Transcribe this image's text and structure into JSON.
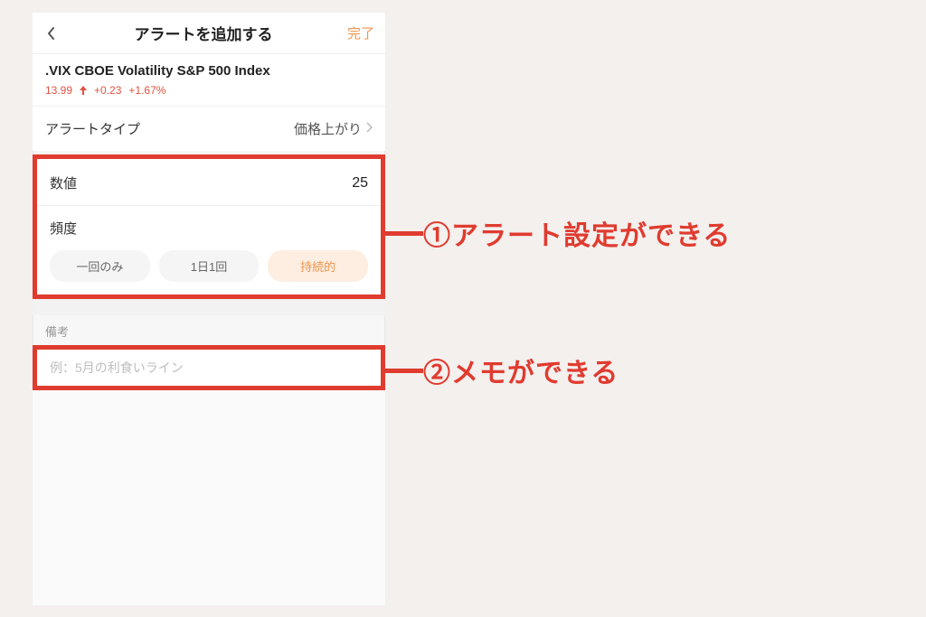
{
  "header": {
    "title": "アラートを追加する",
    "done_label": "完了"
  },
  "ticker": {
    "name": ".VIX  CBOE Volatility S&P 500 Index",
    "price": "13.99",
    "change": "+0.23",
    "percent": "+1.67%"
  },
  "alert_type": {
    "label": "アラートタイプ",
    "value": "価格上がり"
  },
  "value_row": {
    "label": "数値",
    "value": "25"
  },
  "frequency": {
    "label": "頻度",
    "options": [
      "一回のみ",
      "1日1回",
      "持続的"
    ],
    "selected_index": 2
  },
  "memo": {
    "section_label": "備考",
    "placeholder": "例：5月の利食いライン"
  },
  "annotations": {
    "a1": "①アラート設定ができる",
    "a2": "②メモができる"
  },
  "colors": {
    "accent": "#f0944d",
    "highlight": "#e03b2f",
    "up": "#e15241"
  }
}
